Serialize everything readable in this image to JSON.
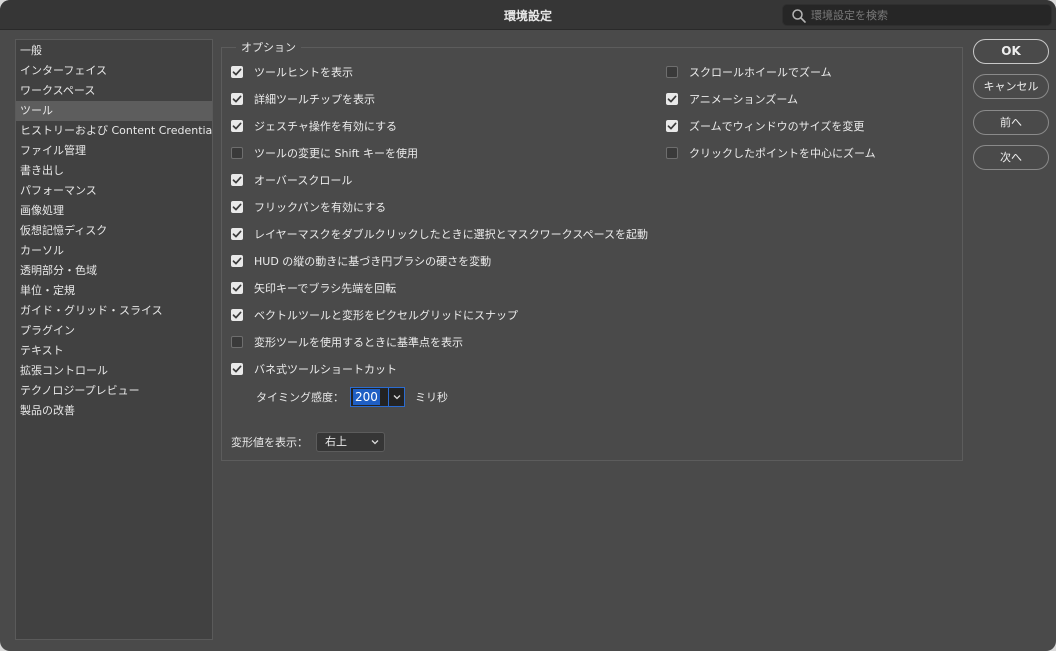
{
  "window": {
    "title": "環境設定"
  },
  "search": {
    "placeholder": "環境設定を検索"
  },
  "sidebar": {
    "items": [
      {
        "label": "一般"
      },
      {
        "label": "インターフェイス"
      },
      {
        "label": "ワークスペース"
      },
      {
        "label": "ツール",
        "selected": true
      },
      {
        "label": "ヒストリーおよび Content Credentials"
      },
      {
        "label": "ファイル管理"
      },
      {
        "label": "書き出し"
      },
      {
        "label": "パフォーマンス"
      },
      {
        "label": "画像処理"
      },
      {
        "label": "仮想記憶ディスク"
      },
      {
        "label": "カーソル"
      },
      {
        "label": "透明部分・色域"
      },
      {
        "label": "単位・定規"
      },
      {
        "label": "ガイド・グリッド・スライス"
      },
      {
        "label": "プラグイン"
      },
      {
        "label": "テキスト"
      },
      {
        "label": "拡張コントロール"
      },
      {
        "label": "テクノロジープレビュー"
      },
      {
        "label": "製品の改善"
      }
    ]
  },
  "options": {
    "title": "オプション",
    "left": [
      {
        "label": "ツールヒントを表示",
        "checked": true
      },
      {
        "label": "詳細ツールチップを表示",
        "checked": true
      },
      {
        "label": "ジェスチャ操作を有効にする",
        "checked": true
      },
      {
        "label": "ツールの変更に Shift キーを使用",
        "checked": false
      },
      {
        "label": "オーバースクロール",
        "checked": true
      },
      {
        "label": "フリックパンを有効にする",
        "checked": true
      },
      {
        "label": "レイヤーマスクをダブルクリックしたときに選択とマスクワークスペースを起動",
        "checked": true
      },
      {
        "label": "HUD の縦の動きに基づき円ブラシの硬さを変動",
        "checked": true
      },
      {
        "label": "矢印キーでブラシ先端を回転",
        "checked": true
      },
      {
        "label": "ベクトルツールと変形をピクセルグリッドにスナップ",
        "checked": true
      },
      {
        "label": "変形ツールを使用するときに基準点を表示",
        "checked": false
      },
      {
        "label": "バネ式ツールショートカット",
        "checked": true
      }
    ],
    "right": [
      {
        "label": "スクロールホイールでズーム",
        "checked": false
      },
      {
        "label": "アニメーションズーム",
        "checked": true
      },
      {
        "label": "ズームでウィンドウのサイズを変更",
        "checked": true
      },
      {
        "label": "クリックしたポイントを中心にズーム",
        "checked": false
      }
    ],
    "timing": {
      "label": "タイミング感度：",
      "value": "200",
      "unit": "ミリ秒"
    },
    "transform": {
      "label": "変形値を表示：",
      "value": "右上"
    }
  },
  "buttons": {
    "ok": "OK",
    "cancel": "キャンセル",
    "prev": "前へ",
    "next": "次へ"
  }
}
